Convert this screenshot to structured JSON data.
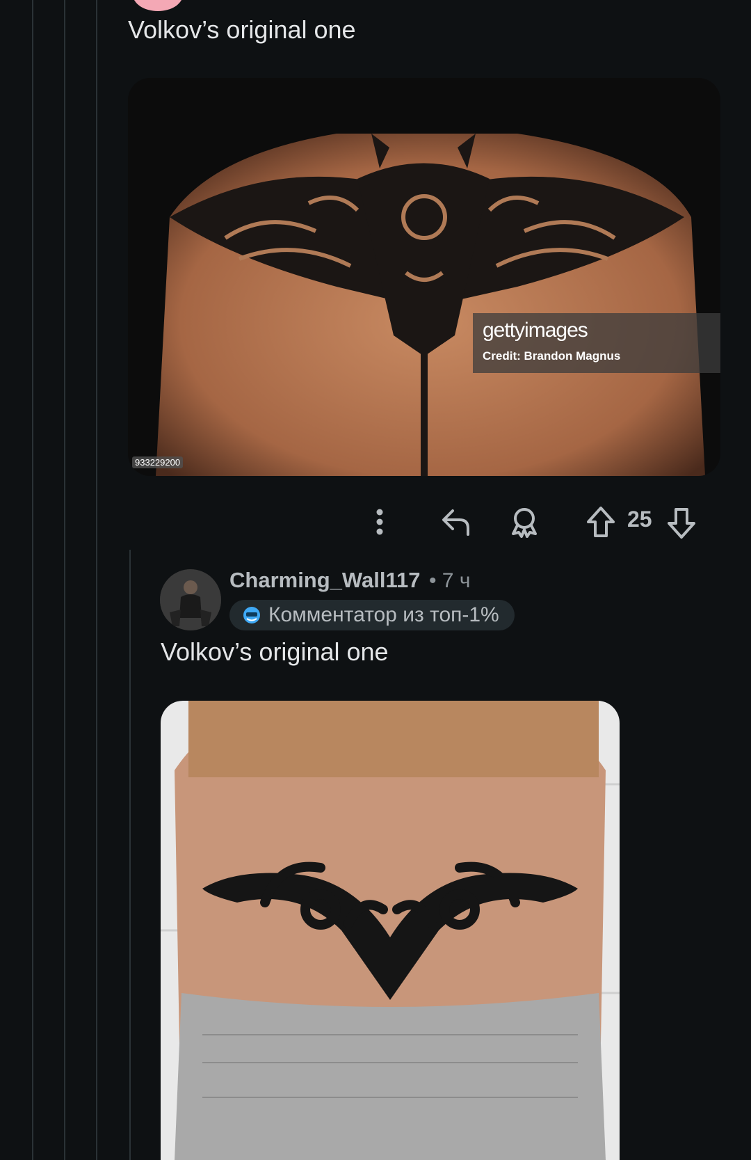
{
  "comment_1": {
    "text": "Volkov’s original one",
    "image": {
      "watermark_brand_bold": "getty",
      "watermark_brand_light": "images",
      "watermark_credit": "Credit: Brandon Magnus",
      "image_id": "933229200"
    },
    "actions": {
      "more_icon": "more-vertical-icon",
      "reply_icon": "reply-icon",
      "award_icon": "award-icon",
      "upvote_icon": "upvote-icon",
      "vote_count": "25",
      "downvote_icon": "downvote-icon"
    }
  },
  "comment_2": {
    "username": "Charming_Wall117",
    "timestamp": "• 7 ч",
    "badge_label": "Комментатор из топ-1%",
    "text": "Volkov’s original one"
  },
  "colors": {
    "background": "#0e1113",
    "thread_line": "#2a3236",
    "badge_bg": "#222a2e",
    "muted_text": "#b7bcc0"
  }
}
